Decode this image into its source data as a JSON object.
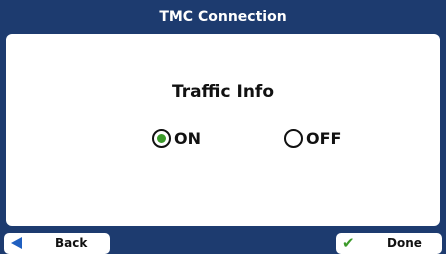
{
  "title": "TMC Connection",
  "setting": {
    "label": "Traffic Info",
    "options": [
      {
        "label": "ON",
        "selected": true
      },
      {
        "label": "OFF",
        "selected": false
      }
    ]
  },
  "footer": {
    "back_label": "Back",
    "done_label": "Done"
  },
  "icons": {
    "back": "left-arrow-icon",
    "done": "checkmark-icon",
    "radio_selected": "radio-selected-icon",
    "radio_unselected": "radio-unselected-icon"
  },
  "colors": {
    "frame": "#1d3b6f",
    "panel": "#ffffff",
    "accent_green": "#3c9a2a",
    "arrow_blue": "#1f5fc0"
  }
}
